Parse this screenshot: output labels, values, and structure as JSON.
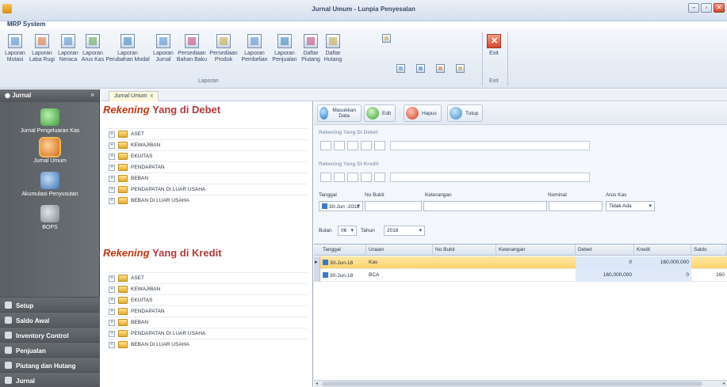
{
  "window": {
    "title": "Jurnal Umum - Lunpia Penyesalan",
    "controls": [
      "–",
      "▫",
      "✕"
    ]
  },
  "ribbon": {
    "tab_label": "MRP System",
    "buttons": [
      {
        "label1": "Laporan",
        "label2": "Mutasi",
        "icon": "report-mutation-icon"
      },
      {
        "label1": "Laporan",
        "label2": "Laba Rugi",
        "icon": "report-profit-loss-icon"
      },
      {
        "label1": "Laporan",
        "label2": "Neraca",
        "icon": "report-balance-icon"
      },
      {
        "label1": "Laporan",
        "label2": "Arus Kas",
        "icon": "report-cashflow-icon"
      },
      {
        "label1": "Laporan",
        "label2": "Perubahan Modal",
        "icon": "report-capital-change-icon"
      },
      {
        "label1": "Laporan",
        "label2": "Jurnal",
        "icon": "report-journal-icon"
      },
      {
        "label1": "Persediaan",
        "label2": "Bahan Baku",
        "icon": "raw-material-stock-icon"
      },
      {
        "label1": "Persediaan",
        "label2": "Produk",
        "icon": "product-stock-icon"
      },
      {
        "label1": "Laporan",
        "label2": "Pembelian",
        "icon": "report-purchase-icon"
      },
      {
        "label1": "Laporan",
        "label2": "Penjualan",
        "icon": "report-sales-icon"
      },
      {
        "label1": "Daftar",
        "label2": "Piutang",
        "icon": "receivables-list-icon"
      },
      {
        "label1": "Daftar",
        "label2": "Hutang",
        "icon": "payables-list-icon"
      }
    ],
    "group_label": "Laporan",
    "exit_label": "Exit",
    "exit_group_label": "Exit"
  },
  "sidebar": {
    "header": "Jurnal",
    "collapse": "«",
    "items": [
      {
        "label": "Jurnal Pengeluaran Kas",
        "icon": "cash-out-journal-icon"
      },
      {
        "label": "Jurnal Umum",
        "icon": "general-journal-icon"
      },
      {
        "label": "Akumulasi Penyusutan",
        "icon": "depreciation-icon"
      },
      {
        "label": "BOPS",
        "icon": "bops-icon"
      }
    ],
    "nav": [
      "Setup",
      "Saldo Awal",
      "Inventory Control",
      "Penjualan",
      "Piutang dan Hutang",
      "Jurnal"
    ]
  },
  "doc_tab": {
    "label": "Jurnal Umum",
    "close": "x"
  },
  "debet_panel": {
    "title_italic": "Rekening",
    "title_rest": "Yang di Debet",
    "tree": [
      "ASET",
      "KEWAJIBAN",
      "EKUITAS",
      "PENDAPATAN",
      "BEBAN",
      "PENDAPATAN DI LUAR USAHA",
      "BEBAN DI LUAR USAHA"
    ]
  },
  "kredit_panel": {
    "title_italic": "Rekening",
    "title_rest": "Yang di Kredit",
    "tree": [
      "ASET",
      "KEWAJIBAN",
      "EKUITAS",
      "PENDAPATAN",
      "BEBAN",
      "PENDAPATAN DI LUAR USAHA",
      "BEBAN DI LUAR USAHA"
    ]
  },
  "toolbar": {
    "add_label": "Masukkan Data",
    "edit_label": "Edit",
    "delete_label": "Hapus",
    "close_label": "Tutup"
  },
  "form": {
    "debet_group": "Rekening Yang Di Debet",
    "kredit_group": "Rekening Yang Di Kredit",
    "labels": {
      "tanggal": "Tanggal",
      "no_bukti": "No Bukti",
      "keterangan": "Keterangan",
      "nominal": "Nominal",
      "arus_kas": "Arus Kas"
    },
    "tanggal_value": "30-Jun -2018",
    "arus_kas_value": "Tidak Ada",
    "filter": {
      "bulan_label": "Bulan",
      "bulan_value": "06",
      "tahun_label": "Tahun",
      "tahun_value": "2018"
    }
  },
  "grid": {
    "columns": [
      "Tanggal",
      "Uraian",
      "No Bukti",
      "Keterangan",
      "Debet",
      "Kredit",
      "Saldo"
    ],
    "rows": [
      {
        "tanggal": "30-Jun-18",
        "uraian": "Kas",
        "no_bukti": "",
        "keterangan": "",
        "debet": "0",
        "kredit": "160,000,000",
        "saldo": "",
        "selected": true
      },
      {
        "tanggal": "30-Jun-18",
        "uraian": "BCA",
        "no_bukti": "",
        "keterangan": "",
        "debet": "160,000,000",
        "kredit": "0",
        "saldo": "160",
        "selected": false
      }
    ]
  },
  "colors": {
    "accent_orange": "#c2360f",
    "selected_row": "#ffd46c",
    "sidebar": "#5a5f63"
  }
}
